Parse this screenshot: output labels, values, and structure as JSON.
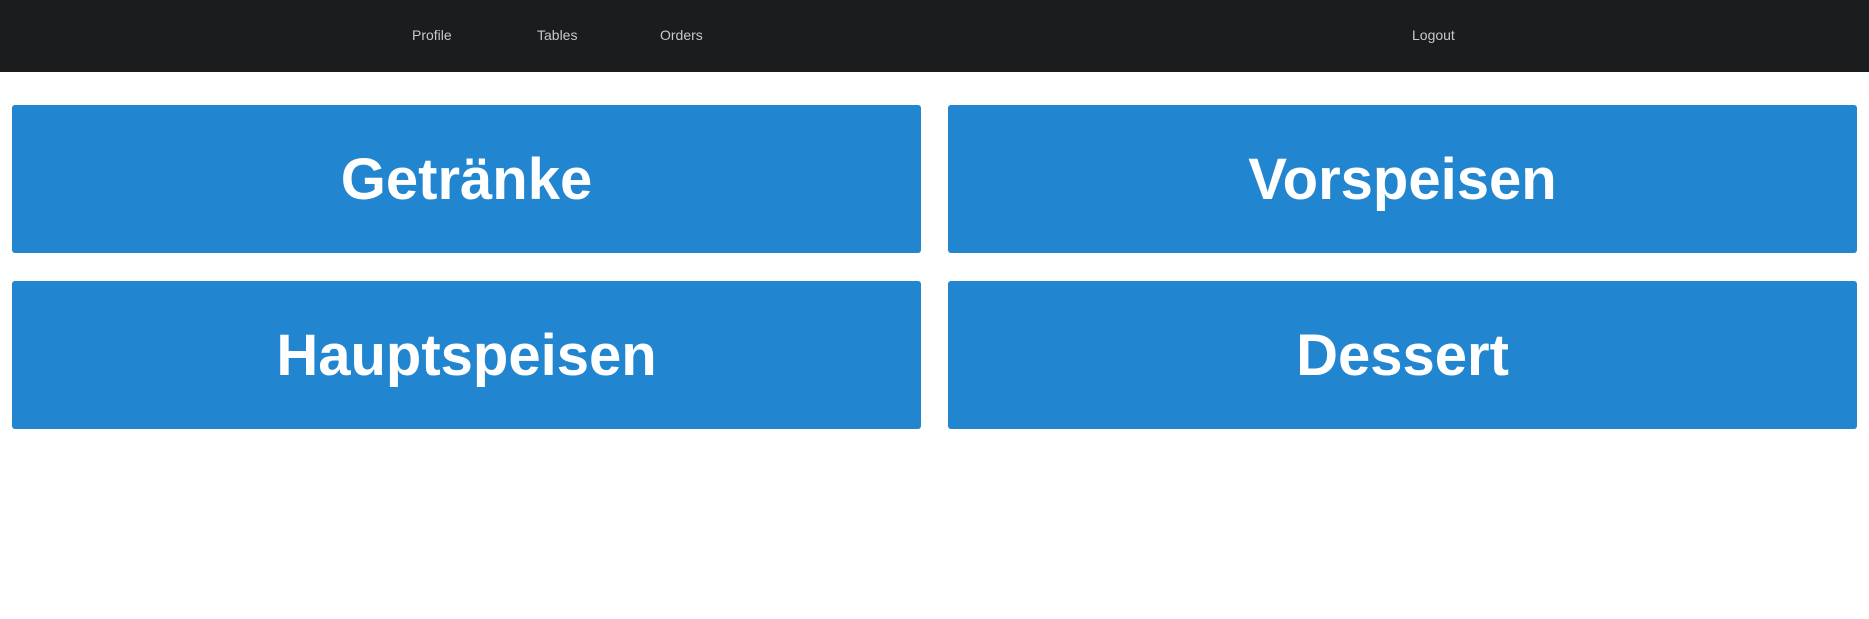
{
  "nav": {
    "profile": "Profile",
    "tables": "Tables",
    "orders": "Orders",
    "logout": "Logout"
  },
  "categories": [
    {
      "label": "Getränke"
    },
    {
      "label": "Vorspeisen"
    },
    {
      "label": "Hauptspeisen"
    },
    {
      "label": "Dessert"
    }
  ],
  "colors": {
    "navbar": "#1b1c1d",
    "nav_text": "#c8c8c8",
    "tile": "#2185d0",
    "tile_text": "#ffffff"
  }
}
